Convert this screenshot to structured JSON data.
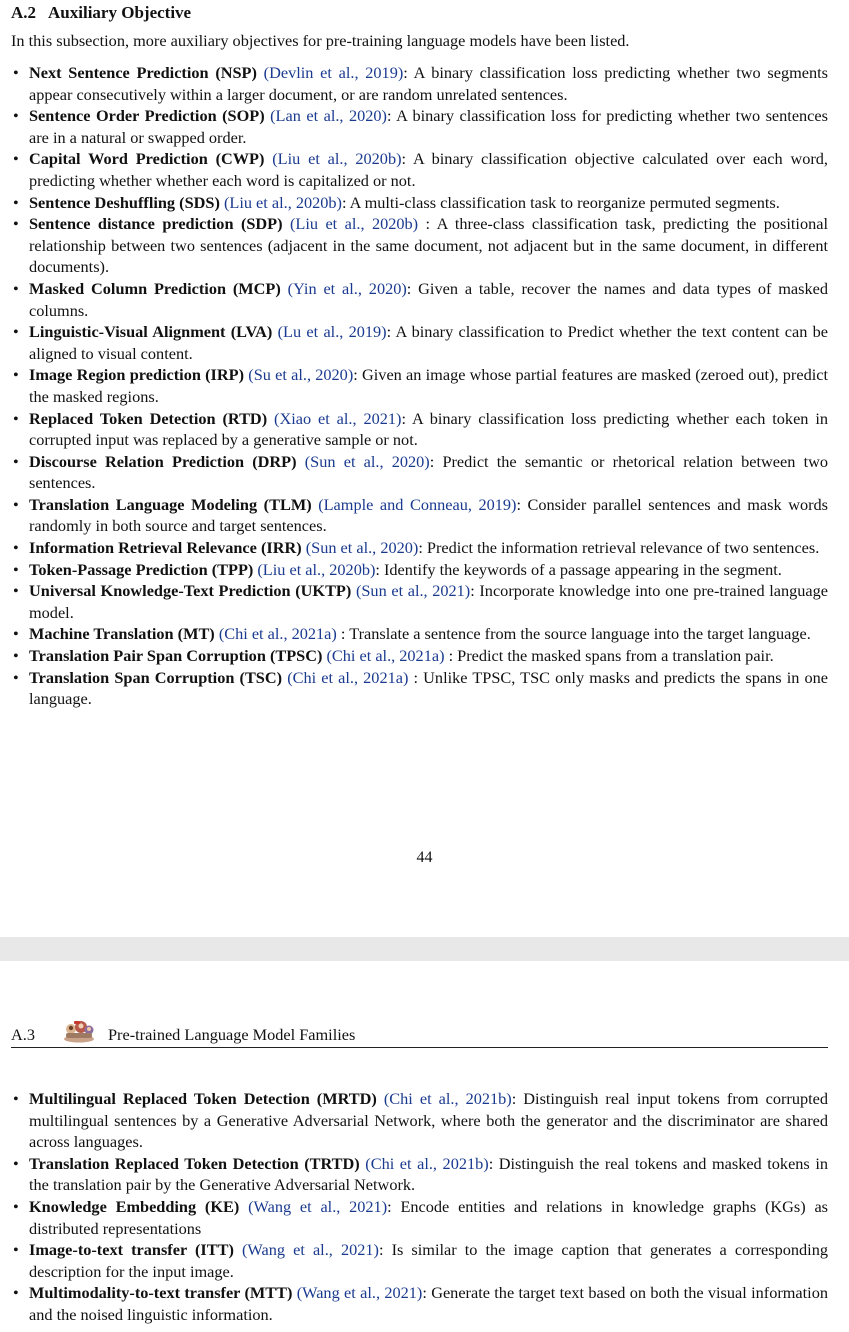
{
  "section_a2": {
    "number": "A.2",
    "title": "Auxiliary Objective",
    "intro": "In this subsection, more auxiliary objectives for pre-training language models have been listed.",
    "items": [
      {
        "term": "Next Sentence Prediction (NSP)",
        "cite": "(Devlin et al., 2019)",
        "text": ": A binary classification loss predicting whether two segments appear consecutively within a larger document, or are random unrelated sentences."
      },
      {
        "term": "Sentence Order Prediction (SOP)",
        "cite": "(Lan et al., 2020)",
        "text": ": A binary classification loss for predicting whether two sentences are in a natural or swapped order."
      },
      {
        "term": "Capital Word Prediction (CWP)",
        "cite": "(Liu et al., 2020b)",
        "text": ": A binary classification objective calculated over each word, predicting whether whether each word is capitalized or not."
      },
      {
        "term": "Sentence Deshuffling (SDS)",
        "cite": "(Liu et al., 2020b)",
        "text": ": A multi-class classification task to reorganize permuted segments."
      },
      {
        "term": "Sentence distance prediction (SDP)",
        "cite": "(Liu et al., 2020b)",
        "text": " : A three-class classification task, predicting the positional relationship between two sentences (adjacent in the same document, not adjacent but in the same document, in different documents)."
      },
      {
        "term": "Masked Column Prediction (MCP)",
        "cite": "(Yin et al., 2020)",
        "text": ": Given a table, recover the names and data types of masked columns."
      },
      {
        "term": "Linguistic-Visual Alignment (LVA)",
        "cite": "(Lu et al., 2019)",
        "text": ": A binary classification to Predict whether the text content can be aligned to visual content."
      },
      {
        "term": "Image Region prediction (IRP)",
        "cite": "(Su et al., 2020)",
        "text": ": Given an image whose partial features are masked (zeroed out), predict the masked regions."
      },
      {
        "term": "Replaced Token Detection (RTD)",
        "cite": "(Xiao et al., 2021)",
        "text": ": A binary classification loss predicting whether each token in corrupted input was replaced by a generative sample or not."
      },
      {
        "term": "Discourse Relation Prediction (DRP)",
        "cite": "(Sun et al., 2020)",
        "text": ": Predict the semantic or rhetorical relation between two sentences."
      },
      {
        "term": "Translation Language Modeling (TLM)",
        "cite": "(Lample and Conneau, 2019)",
        "text": ": Consider parallel sentences and mask words randomly in both source and target sentences."
      },
      {
        "term": "Information Retrieval Relevance (IRR)",
        "cite": "(Sun et al., 2020)",
        "text": ": Predict the information retrieval relevance of two sentences."
      },
      {
        "term": "Token-Passage Prediction (TPP)",
        "cite": "(Liu et al., 2020b)",
        "text": ": Identify the keywords of a passage appearing in the segment."
      },
      {
        "term": "Universal Knowledge-Text Prediction (UKTP)",
        "cite": "(Sun et al., 2021)",
        "text": ": Incorporate knowledge into one pre-trained language model."
      },
      {
        "term": "Machine Translation (MT)",
        "cite": "(Chi et al., 2021a)",
        "text": " : Translate a sentence from the source language into the target language."
      },
      {
        "term": "Translation Pair Span Corruption (TPSC)",
        "cite": "(Chi et al., 2021a)",
        "text": " : Predict the masked spans from a translation pair."
      },
      {
        "term": "Translation Span Corruption (TSC)",
        "cite": "(Chi et al., 2021a)",
        "text": " : Unlike TPSC, TSC only masks and predicts the spans in one language."
      }
    ]
  },
  "page_number": "44",
  "section_a3": {
    "number": "A.3",
    "title": "Pre-trained Language Model Families",
    "logo_icon": "pretrained-model-family-logo",
    "items": [
      {
        "term": "Multilingual Replaced Token Detection (MRTD)",
        "cite": "(Chi et al., 2021b)",
        "text": ": Distinguish real input tokens from corrupted multilingual sentences by a Generative Adversarial Network, where both the generator and the discriminator are shared across languages."
      },
      {
        "term": "Translation Replaced Token Detection (TRTD)",
        "cite": "(Chi et al., 2021b)",
        "text": ": Distinguish the real tokens and masked tokens in the translation pair by the Generative Adversarial Network."
      },
      {
        "term": "Knowledge Embedding (KE)",
        "cite": "(Wang et al., 2021)",
        "text": ": Encode entities and relations in knowledge graphs (KGs) as distributed representations"
      },
      {
        "term": "Image-to-text transfer (ITT)",
        "cite": "(Wang et al., 2021)",
        "text": ": Is similar to the image caption that generates a corresponding description for the input image."
      },
      {
        "term": "Multimodality-to-text transfer (MTT)",
        "cite": "(Wang et al., 2021)",
        "text": ": Generate the target text based on both the visual information and the noised linguistic information."
      }
    ]
  },
  "colors": {
    "citation": "#1a3a8f",
    "page_gap": "#e8e8e8"
  }
}
